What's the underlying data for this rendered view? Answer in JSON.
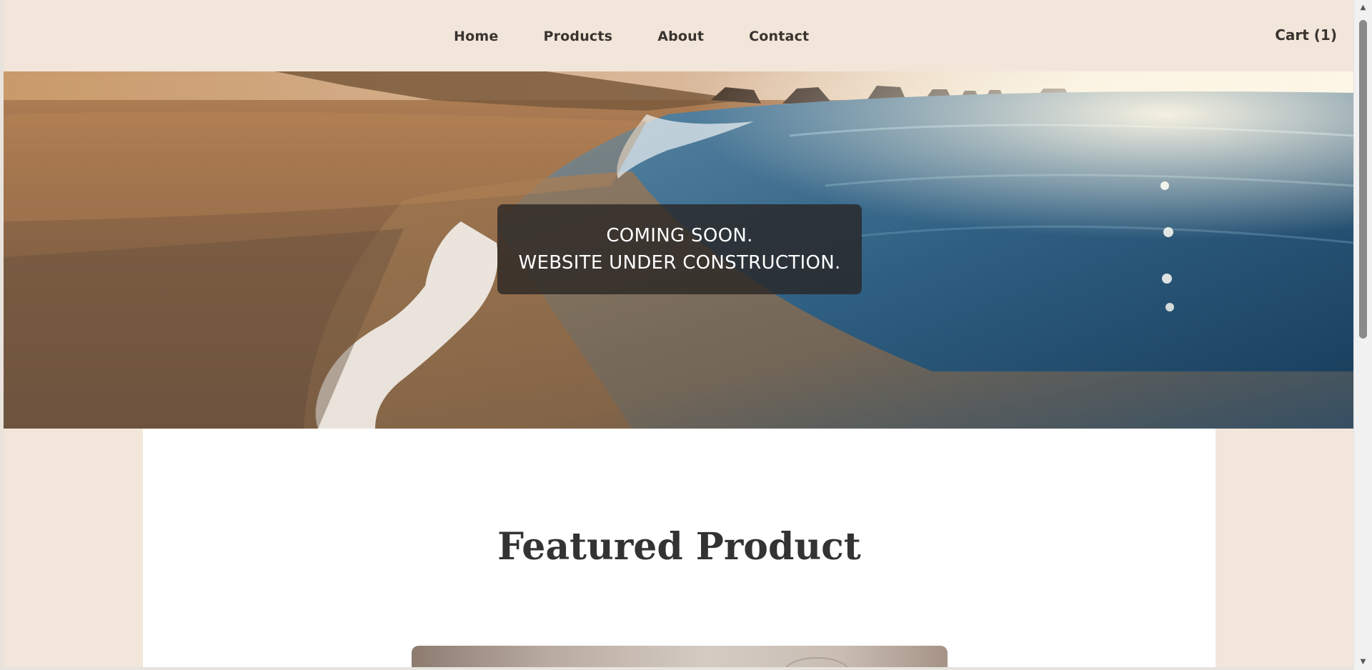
{
  "nav": {
    "items": [
      {
        "label": "Home"
      },
      {
        "label": "Products"
      },
      {
        "label": "About"
      },
      {
        "label": "Contact"
      }
    ],
    "cart_label": "Cart (1)"
  },
  "hero": {
    "line1": "COMING SOON.",
    "line2": "WEBSITE UNDER CONSTRUCTION.",
    "image": "beach-waves-sunset-photo"
  },
  "main": {
    "featured_title": "Featured Product"
  },
  "colors": {
    "page_background": "#f2e6da",
    "content_background": "#ffffff",
    "text": "#3a3430",
    "overlay": "#282422"
  },
  "icons": {
    "scroll_up": "scroll-up-arrow-icon",
    "scroll_down": "scroll-down-arrow-icon"
  }
}
